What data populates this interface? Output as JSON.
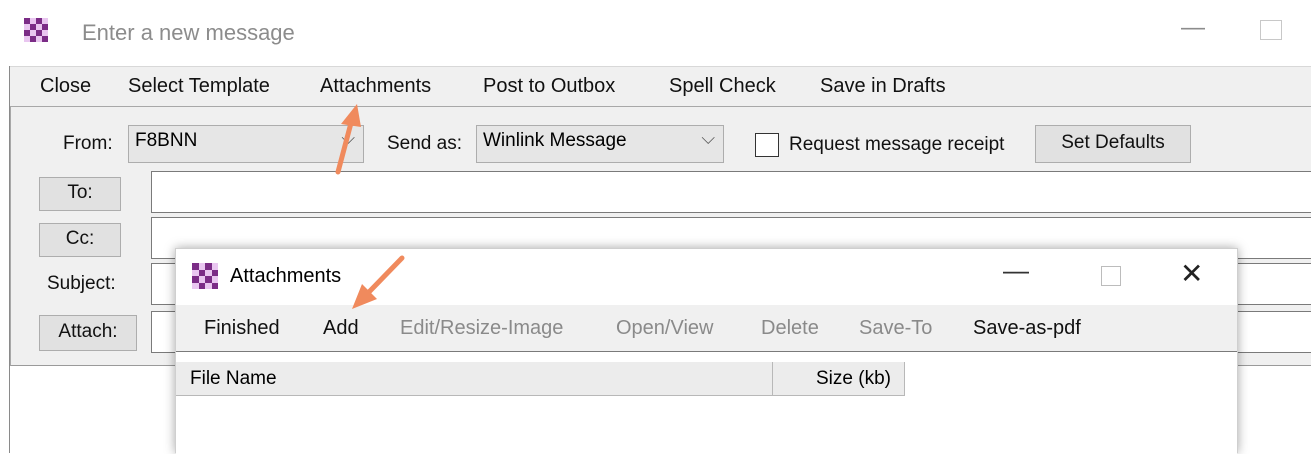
{
  "main_window": {
    "title": "Enter a new message",
    "menu": [
      "Close",
      "Select Template",
      "Attachments",
      "Post to Outbox",
      "Spell Check",
      "Save in Drafts"
    ]
  },
  "form": {
    "from_label": "From:",
    "from_value": "F8BNN",
    "send_as_label": "Send as:",
    "send_as_value": "Winlink Message",
    "request_receipt_label": "Request message receipt",
    "request_receipt_checked": false,
    "set_defaults_label": "Set Defaults",
    "to_label": "To:",
    "to_value": "",
    "cc_label": "Cc:",
    "cc_value": "",
    "subject_label": "Subject:",
    "subject_value": "",
    "attach_label": "Attach:",
    "attach_value": ""
  },
  "attachments_dialog": {
    "title": "Attachments",
    "menu": [
      {
        "label": "Finished",
        "enabled": true
      },
      {
        "label": "Add",
        "enabled": true
      },
      {
        "label": "Edit/Resize-Image",
        "enabled": false
      },
      {
        "label": "Open/View",
        "enabled": false
      },
      {
        "label": "Delete",
        "enabled": false
      },
      {
        "label": "Save-To",
        "enabled": false
      },
      {
        "label": "Save-as-pdf",
        "enabled": true
      }
    ],
    "columns": [
      "File Name",
      "Size (kb)"
    ],
    "rows": []
  },
  "colors": {
    "annotation_arrow": "#f08a5d",
    "app_icon_dark": "#7b2c86",
    "app_icon_light": "#e9c6f0"
  },
  "icons": {
    "app": "checkered-app-icon",
    "minimize": "minimize-icon",
    "maximize": "maximize-icon",
    "close": "close-icon",
    "dropdown": "chevron-down-icon"
  }
}
